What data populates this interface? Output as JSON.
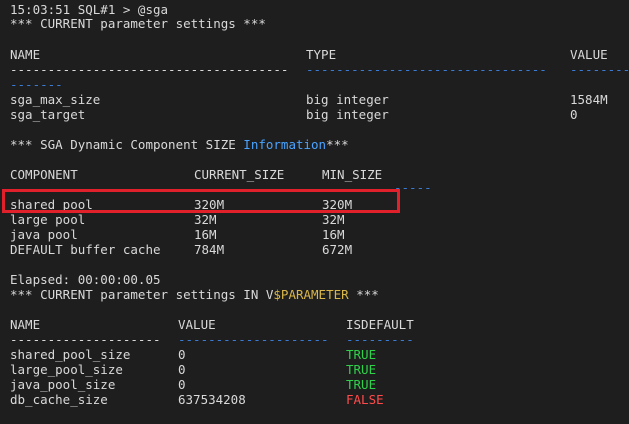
{
  "prompt_line": "15:03:51 SQL#1 > @sga",
  "header1": "*** CURRENT parameter settings ***",
  "params_table": {
    "headers": [
      "NAME",
      "TYPE",
      "VALUE"
    ],
    "dashes": [
      "-------------------------------------",
      "--------------------------------",
      "--------"
    ],
    "dash_wrap": "-------",
    "rows": [
      [
        "sga_max_size",
        "big integer",
        "1584M"
      ],
      [
        "sga_target",
        "big integer",
        "0"
      ]
    ]
  },
  "header2": {
    "prefix": "*** SGA Dynamic Component SIZE ",
    "highlight": "Information",
    "suffix": "***"
  },
  "components_table": {
    "headers": [
      "COMPONENT",
      "CURRENT_SIZE",
      "MIN_SIZE"
    ],
    "dash_tail": "-----",
    "rows": [
      [
        "shared pool",
        "320M",
        "320M"
      ],
      [
        "large pool",
        "32M",
        "32M"
      ],
      [
        "java pool",
        "16M",
        "16M"
      ],
      [
        "DEFAULT buffer cache",
        "784M",
        "672M"
      ]
    ]
  },
  "elapsed": "Elapsed: 00:00:00.05",
  "header3": {
    "prefix": "*** CURRENT parameter settings IN V",
    "highlight": "$PARAMETER",
    "suffix": " ***"
  },
  "vparam_table": {
    "headers": [
      "NAME",
      "VALUE",
      "ISDEFAULT"
    ],
    "dashes": [
      "--------------------",
      "--------------------",
      "---------"
    ],
    "rows": [
      [
        "shared_pool_size",
        "0",
        "TRUE"
      ],
      [
        "large_pool_size",
        "0",
        "TRUE"
      ],
      [
        "java_pool_size",
        "0",
        "TRUE"
      ],
      [
        "db_cache_size",
        "637534208",
        "FALSE"
      ]
    ]
  },
  "colors": {
    "background": "#1e1e1e",
    "text": "#d9d9d9",
    "true": "#2fd14a",
    "false": "#ff4b4b",
    "link_blue": "#4aa3ff",
    "highlight_gold": "#d9b64a",
    "annotation_box": "#e0202a"
  }
}
